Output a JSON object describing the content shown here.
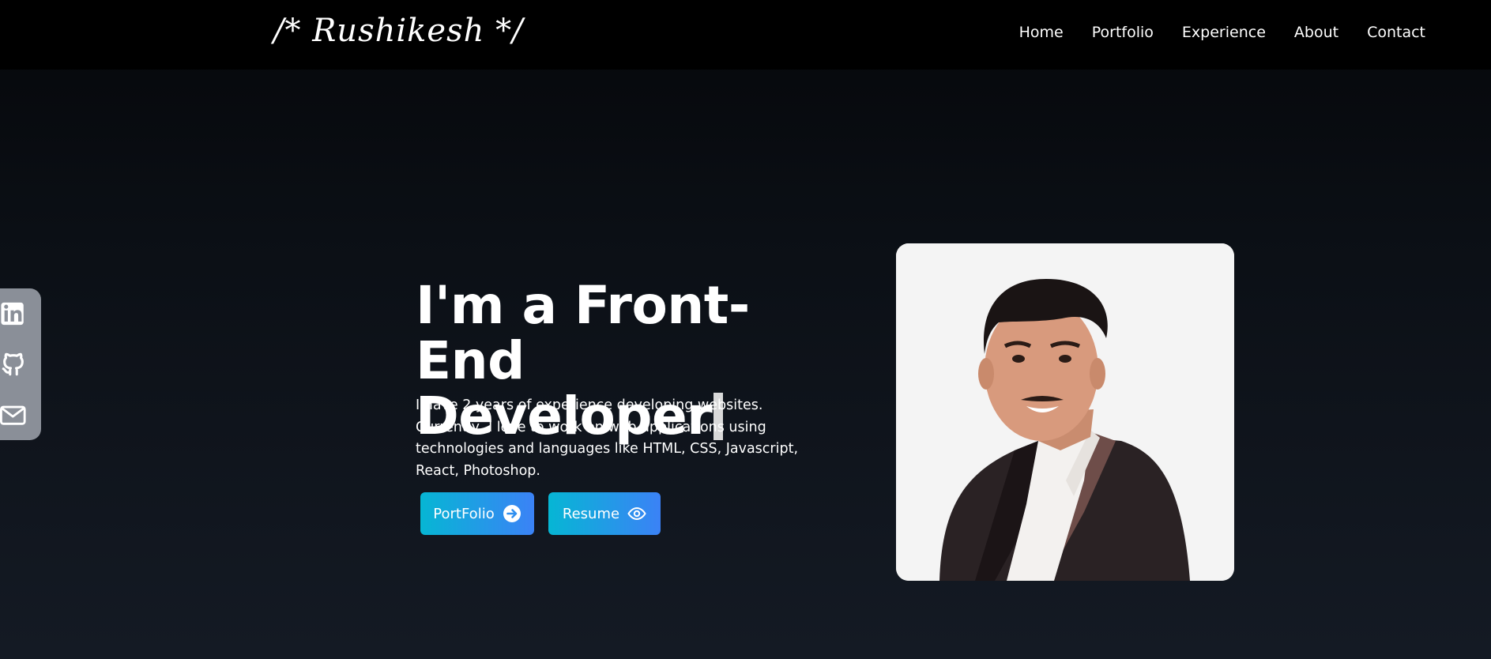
{
  "navbar": {
    "logo": "/* Rushikesh */",
    "links": [
      "Home",
      "Portfolio",
      "Experience",
      "About",
      "Contact"
    ]
  },
  "socials": [
    {
      "icon": "linkedin-icon"
    },
    {
      "icon": "github-icon"
    },
    {
      "icon": "mail-icon"
    }
  ],
  "hero": {
    "title_line1": "I'm a Front-End",
    "title_line2": "Developer",
    "description": "I have 2 years of experience developing websites. Currently, I love to work on web applications using technologies and languages like HTML, CSS, Javascript, React, Photoshop.",
    "buttons": {
      "portfolio": "PortFolio",
      "resume": "Resume"
    }
  },
  "colors": {
    "button_gradient_start": "#06b6d4",
    "button_gradient_end": "#3b82f6",
    "social_bg": "#8a8f98",
    "navbar_bg": "#000000"
  }
}
